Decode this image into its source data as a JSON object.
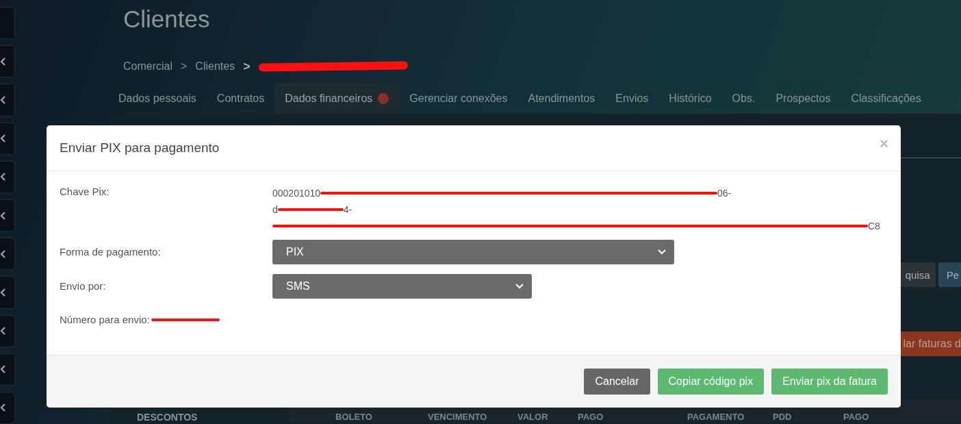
{
  "page": {
    "title": "Clientes"
  },
  "breadcrumb": [
    {
      "label": "Comercial",
      "kind": "link"
    },
    {
      "label": ">",
      "kind": "separator"
    },
    {
      "label": "Clientes",
      "kind": "link"
    },
    {
      "label": ">",
      "kind": "current-separator"
    },
    {
      "kind": "redacted"
    }
  ],
  "tabs": [
    {
      "label": "Dados pessoais",
      "selected": false,
      "alert": false
    },
    {
      "label": "Contratos",
      "selected": false,
      "alert": false
    },
    {
      "label": "Dados financeiros",
      "selected": true,
      "alert": true
    },
    {
      "label": "Gerenciar conexões",
      "selected": false,
      "alert": false
    },
    {
      "label": "Atendimentos",
      "selected": false,
      "alert": false
    },
    {
      "label": "Envios",
      "selected": false,
      "alert": false
    },
    {
      "label": "Histórico",
      "selected": false,
      "alert": false
    },
    {
      "label": "Obs.",
      "selected": false,
      "alert": false
    },
    {
      "label": "Prospectos",
      "selected": false,
      "alert": false
    },
    {
      "label": "Classificações",
      "selected": false,
      "alert": false
    }
  ],
  "background": {
    "buttons": [
      {
        "label": "quisa",
        "kind": "secondary"
      },
      {
        "label": "Pe",
        "kind": "primary"
      }
    ],
    "danger_button": "lar faturas d",
    "side_label": "DESCONTOS",
    "table_headers": [
      "BOLETO",
      "VENCIMENTO",
      "VALOR",
      "PAGO",
      "PAGAMENTO",
      "PDD",
      "PAGO"
    ]
  },
  "modal": {
    "title": "Enviar PIX para pagamento",
    "close": "×",
    "pix_key": {
      "label": "Chave Pix:",
      "lines": [
        [
          {
            "kind": "text",
            "text": "000201010"
          },
          {
            "kind": "redacted"
          },
          {
            "kind": "text",
            "text": "06-"
          }
        ],
        [
          {
            "kind": "text",
            "text": "d"
          },
          {
            "kind": "redacted"
          },
          {
            "kind": "text",
            "text": "4-"
          }
        ],
        [
          {
            "kind": "redacted"
          },
          {
            "kind": "text",
            "text": "C8"
          }
        ]
      ]
    },
    "fields": [
      {
        "label": "Forma de pagamento:",
        "value": "PIX",
        "kind": "wide"
      },
      {
        "label": "Envio por:",
        "value": "SMS",
        "kind": "narrow"
      }
    ],
    "phone": {
      "label": "Número para envio:",
      "redacted": true
    },
    "buttons": [
      {
        "label": "Cancelar",
        "kind": "default"
      },
      {
        "label": "Copiar código pix",
        "kind": "success"
      },
      {
        "label": "Enviar pix da fatura",
        "kind": "success"
      }
    ]
  }
}
